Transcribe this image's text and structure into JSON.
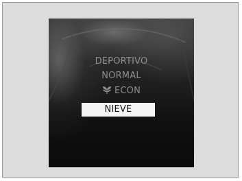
{
  "drive_mode_menu": {
    "items": [
      {
        "label": "DEPORTIVO",
        "selected": false
      },
      {
        "label": "NORMAL",
        "selected": false
      },
      {
        "label": "ECON",
        "icon": "leaf-icon",
        "selected": false
      },
      {
        "label": "NIEVE",
        "selected": true
      }
    ]
  },
  "colors": {
    "frame_background": "#dcdcdc",
    "screen_background": "#121212",
    "item_text": "#8e8e8e",
    "selected_background": "#f4f4f4",
    "selected_text": "#111111"
  }
}
